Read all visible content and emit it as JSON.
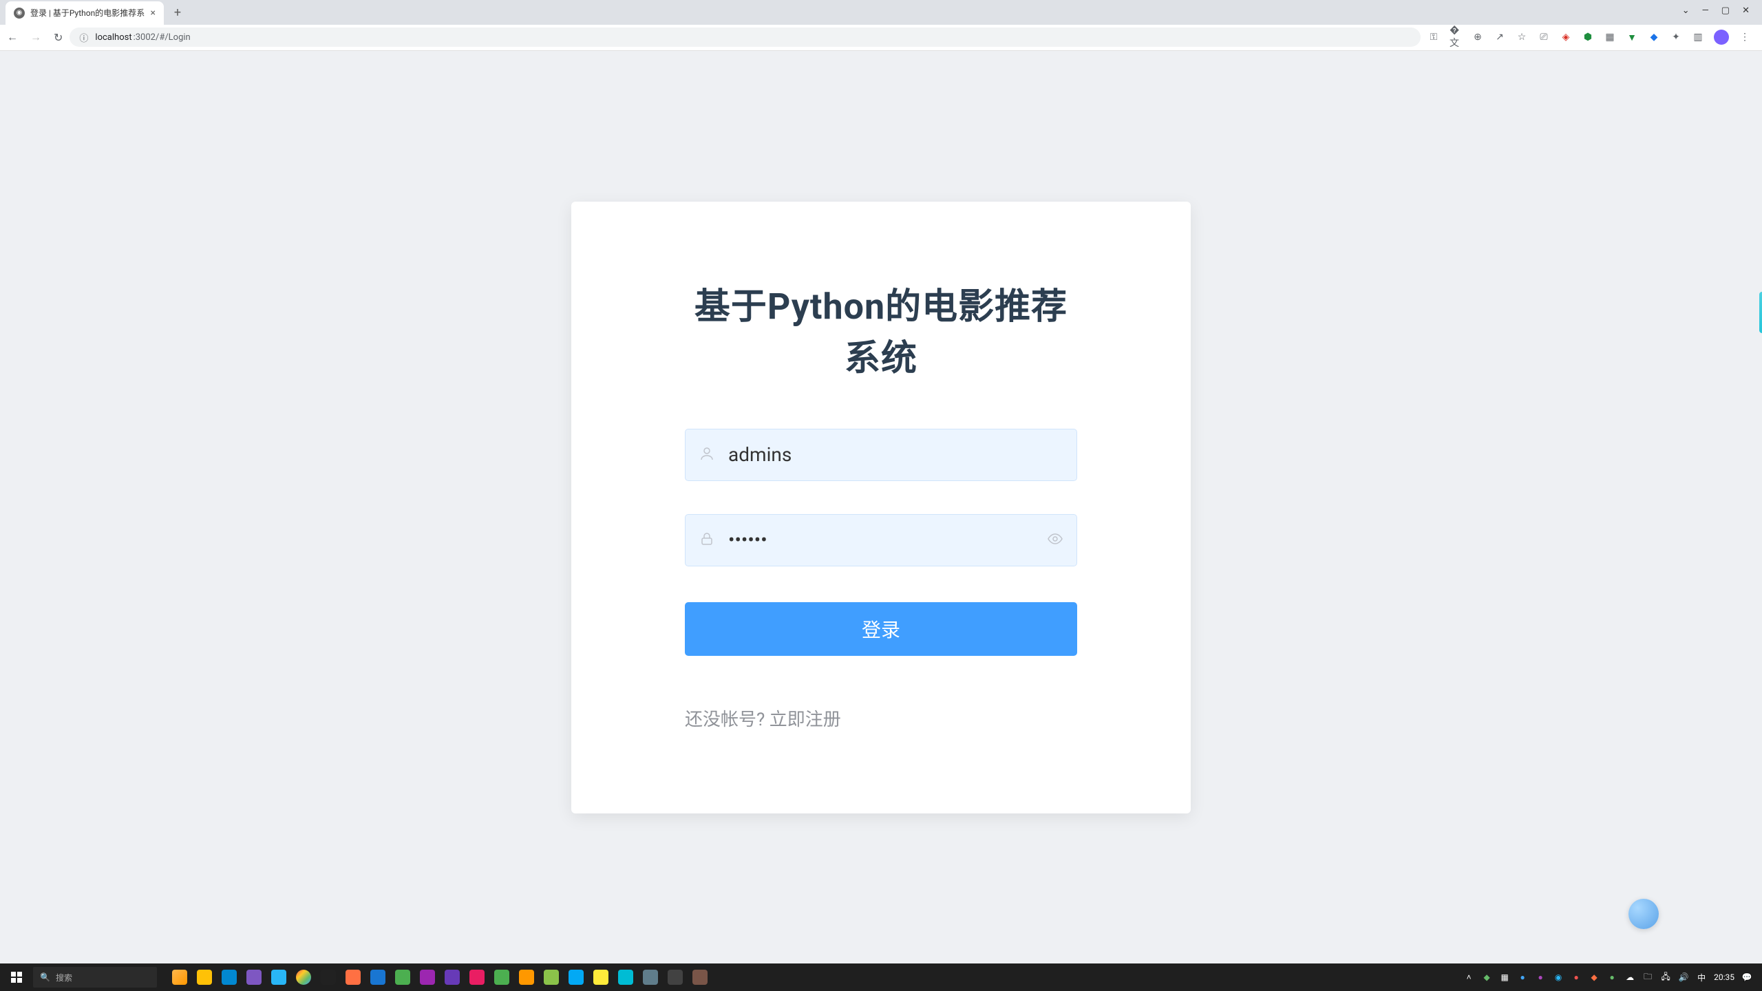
{
  "browser": {
    "tab_title": "登录 | 基于Python的电影推荐系",
    "url_host": "localhost",
    "url_path": ":3002/#/Login",
    "new_tab_symbol": "+",
    "close_symbol": "×"
  },
  "window": {
    "dropdown": "⌄",
    "minimize": "—",
    "maximize": "▢",
    "close": "✕"
  },
  "nav": {
    "back": "←",
    "forward": "→",
    "reload": "↻",
    "info": "ⓘ"
  },
  "login": {
    "title": "基于Python的电影推荐系统",
    "username_value": "admins",
    "password_value": "••••••",
    "submit_label": "登录",
    "register_prompt": "还没帐号? ",
    "register_link": "立即注册"
  },
  "taskbar": {
    "search_placeholder": "搜索",
    "ime": "中",
    "time": "20:35"
  }
}
